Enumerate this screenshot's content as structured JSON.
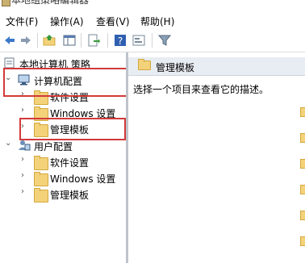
{
  "window": {
    "title": "本地组策略编辑器"
  },
  "menu": [
    "文件(F)",
    "操作(A)",
    "查看(V)",
    "帮助(H)"
  ],
  "toolbar": {
    "icons": [
      "back-arrow-icon",
      "forward-arrow-icon",
      "up-folder-icon",
      "show-hide-tree-icon",
      "export-list-icon",
      "help-icon",
      "properties-icon",
      "filter-icon"
    ]
  },
  "tree": {
    "root": "本地计算机 策略",
    "computer_config": "计算机配置",
    "computer_children": [
      "软件设置",
      "Windows 设置",
      "管理模板"
    ],
    "user_config": "用户配置",
    "user_children": [
      "软件设置",
      "Windows 设置",
      "管理模板"
    ]
  },
  "right_pane": {
    "header": "管理模板",
    "description": "选择一个项目来查看它的描述。"
  },
  "colors": {
    "highlight": "#d23a3a",
    "folder": "#f3d27a"
  }
}
